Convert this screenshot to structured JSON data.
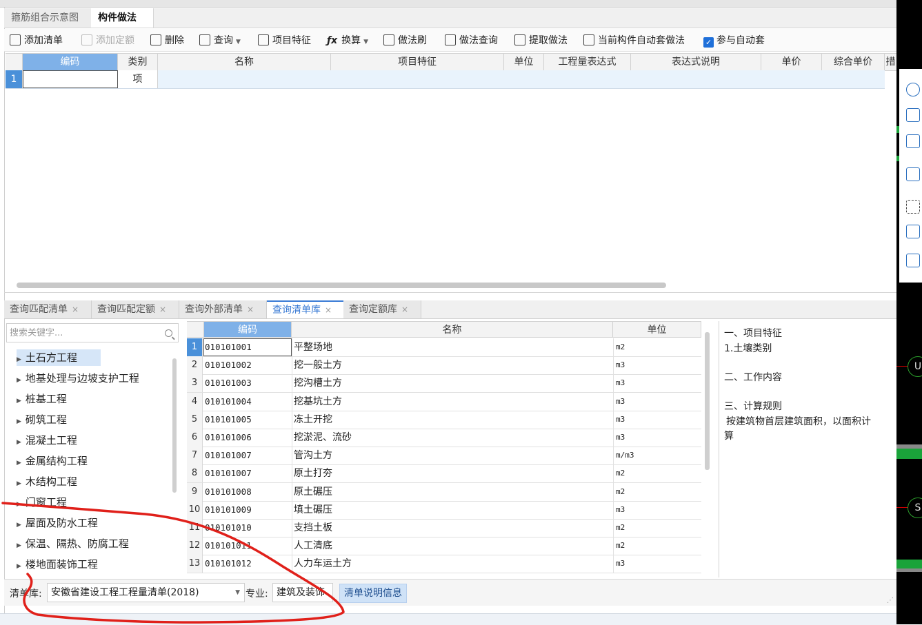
{
  "top_tabs": [
    "箍筋组合示意图",
    "构件做法"
  ],
  "toolbar": {
    "add_list": "添加清单",
    "add_quota": "添加定额",
    "delete": "删除",
    "query": "查询",
    "item_feature": "项目特征",
    "convert": "换算",
    "method_brush": "做法刷",
    "method_query": "做法查询",
    "extract_method": "提取做法",
    "auto_method": "当前构件自动套做法",
    "participate_auto": "参与自动套"
  },
  "upper_grid": {
    "headers": [
      "编码",
      "类别",
      "名称",
      "项目特征",
      "单位",
      "工程量表达式",
      "表达式说明",
      "单价",
      "综合单价",
      "措"
    ],
    "row": {
      "num": "1",
      "code": "",
      "type": "项"
    }
  },
  "bottom_tabs": [
    "查询匹配清单",
    "查询匹配定额",
    "查询外部清单",
    "查询清单库",
    "查询定额库"
  ],
  "search": {
    "placeholder": "搜索关键字..."
  },
  "tree": [
    "土石方工程",
    "地基处理与边坡支护工程",
    "桩基工程",
    "砌筑工程",
    "混凝土工程",
    "金属结构工程",
    "木结构工程",
    "门窗工程",
    "屋面及防水工程",
    "保温、隔热、防腐工程",
    "楼地面装饰工程"
  ],
  "list": {
    "headers": [
      "编码",
      "名称",
      "单位"
    ],
    "rows": [
      {
        "num": "1",
        "code": "010101001",
        "name": "平整场地",
        "unit": "m2"
      },
      {
        "num": "2",
        "code": "010101002",
        "name": "挖一般土方",
        "unit": "m3"
      },
      {
        "num": "3",
        "code": "010101003",
        "name": "挖沟槽土方",
        "unit": "m3"
      },
      {
        "num": "4",
        "code": "010101004",
        "name": "挖基坑土方",
        "unit": "m3"
      },
      {
        "num": "5",
        "code": "010101005",
        "name": "冻土开挖",
        "unit": "m3"
      },
      {
        "num": "6",
        "code": "010101006",
        "name": "挖淤泥、流砂",
        "unit": "m3"
      },
      {
        "num": "7",
        "code": "010101007",
        "name": "管沟土方",
        "unit": "m/m3"
      },
      {
        "num": "8",
        "code": "010101007",
        "name": "原土打夯",
        "unit": "m2"
      },
      {
        "num": "9",
        "code": "010101008",
        "name": "原土碾压",
        "unit": "m2"
      },
      {
        "num": "10",
        "code": "010101009",
        "name": "填土碾压",
        "unit": "m3"
      },
      {
        "num": "11",
        "code": "010101010",
        "name": "支挡土板",
        "unit": "m2"
      },
      {
        "num": "12",
        "code": "010101011",
        "name": "人工清底",
        "unit": "m2"
      },
      {
        "num": "13",
        "code": "010101012",
        "name": "人力车运土方",
        "unit": "m3"
      }
    ]
  },
  "description": {
    "lines": [
      "一、项目特征",
      "1.土壤类别",
      "二、工作内容",
      "三、计算规则",
      "按建筑物首层建筑面积，以面积计",
      "算"
    ]
  },
  "bottom_bar": {
    "library_label": "清单库:",
    "library_value": "安徽省建设工程工程量清单(2018)",
    "specialty_label": "专业:",
    "specialty_value": "建筑及装饰",
    "info_button": "清单说明信息"
  },
  "right_panel": {
    "circle_letters": [
      "U",
      "S"
    ]
  },
  "colors": {
    "accent": "#3a7bd5",
    "header_selected": "#7fb1e8",
    "row_selected": "#e9f3fc",
    "annotation": "#e0201a"
  }
}
